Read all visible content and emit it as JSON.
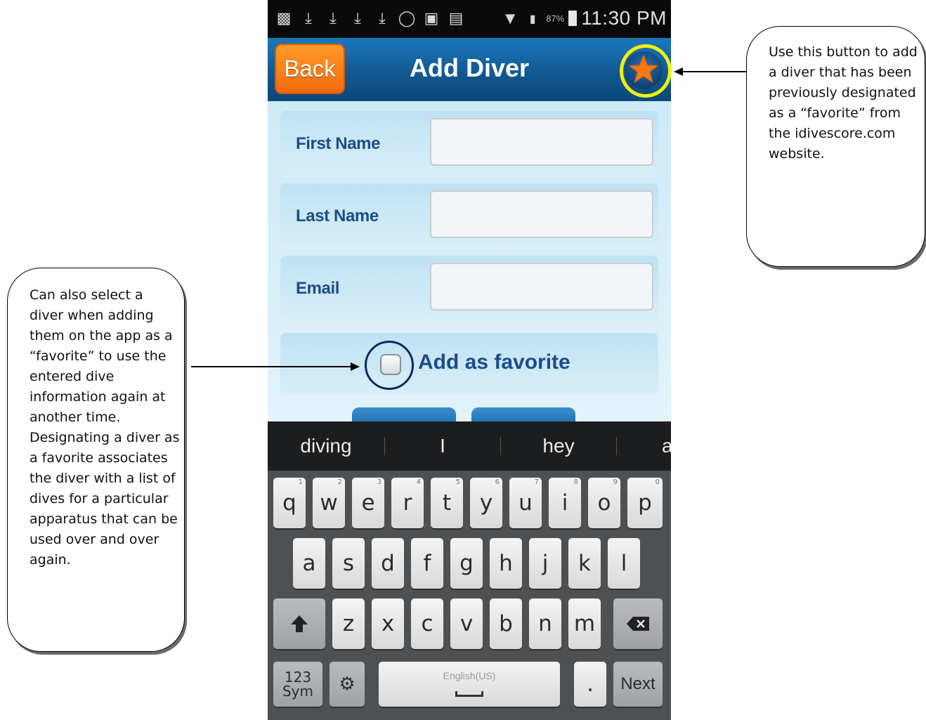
{
  "status_bar": {
    "battery": "87%",
    "time": "11:30 PM"
  },
  "app_bar": {
    "back_label": "Back",
    "title": "Add Diver",
    "favorites_icon": "star-icon",
    "accent_orange": "#f47a16"
  },
  "form": {
    "first_name_label": "First Name",
    "last_name_label": "Last Name",
    "email_label": "Email",
    "first_name_value": "",
    "last_name_value": "",
    "email_value": "",
    "favorite_checkbox_label": "Add as favorite",
    "favorite_checked": false
  },
  "keyboard": {
    "suggestions": [
      "diving",
      "I",
      "hey",
      "a"
    ],
    "row1": [
      {
        "key": "q",
        "hint": "1"
      },
      {
        "key": "w",
        "hint": "2"
      },
      {
        "key": "e",
        "hint": "3"
      },
      {
        "key": "r",
        "hint": "4"
      },
      {
        "key": "t",
        "hint": "5"
      },
      {
        "key": "y",
        "hint": "6"
      },
      {
        "key": "u",
        "hint": "7"
      },
      {
        "key": "i",
        "hint": "8"
      },
      {
        "key": "o",
        "hint": "9"
      },
      {
        "key": "p",
        "hint": "0"
      }
    ],
    "row2": [
      "a",
      "s",
      "d",
      "f",
      "g",
      "h",
      "j",
      "k",
      "l"
    ],
    "row3": [
      "z",
      "x",
      "c",
      "v",
      "b",
      "n",
      "m"
    ],
    "shift_icon": "shift-arrow-icon",
    "backspace_icon": "backspace-icon",
    "sym_line1": "123",
    "sym_line2": "Sym",
    "settings_icon": "gear-icon",
    "space_label": "English(US)",
    "period_label": ".",
    "next_label": "Next"
  },
  "callouts": {
    "favorites_button_note": "Use this button to add a diver that has been previously designated as a “favorite” from the idivescore.com website.",
    "favorite_checkbox_note": "Can also select a diver when adding them on the app as a “favorite” to use the entered dive information again at another time.  Designating a diver as a favorite associates the diver with a list of dives for a particular apparatus that can be used over and over again."
  }
}
